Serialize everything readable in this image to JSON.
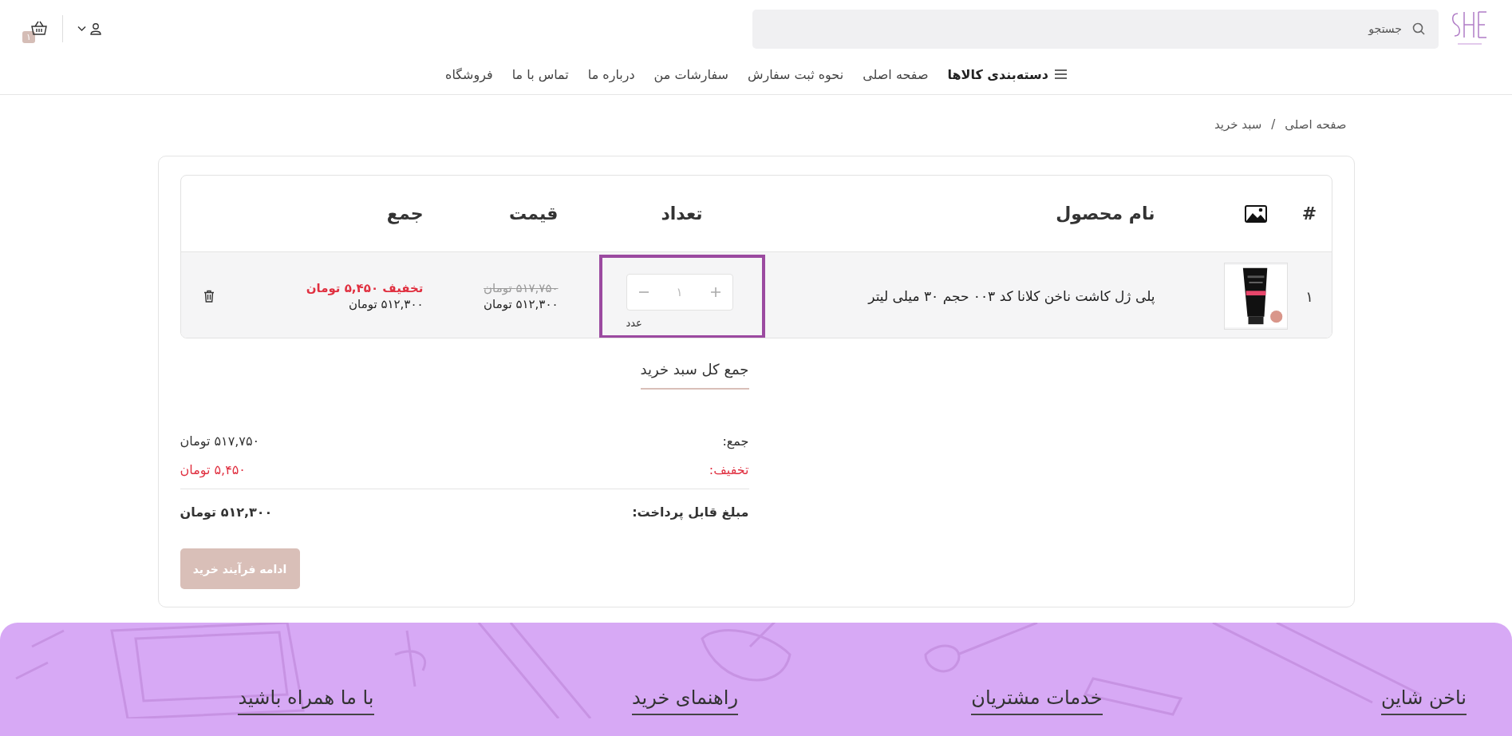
{
  "header": {
    "search": {
      "placeholder": "جستجو"
    },
    "cart_count": "۱"
  },
  "nav": [
    {
      "label": "دسته‌بندی کالاها",
      "kind": "menu"
    },
    {
      "label": "صفحه اصلی",
      "kind": "link"
    },
    {
      "label": "نحوه ثبت سفارش",
      "kind": "link"
    },
    {
      "label": "سفارشات من",
      "kind": "link"
    },
    {
      "label": "درباره ما",
      "kind": "link"
    },
    {
      "label": "تماس با ما",
      "kind": "link"
    },
    {
      "label": "فروشگاه",
      "kind": "link"
    }
  ],
  "breadcrumb": {
    "items": [
      "صفحه اصلی",
      "سبد خرید"
    ],
    "separator": "/"
  },
  "table": {
    "columns": [
      "#",
      "نام محصول",
      "تعداد",
      "قیمت",
      "جمع"
    ],
    "rows": [
      {
        "number": "۱",
        "name": "پلی ژل کاشت ناخن کلانا کد ۰۰۳ حجم ۳۰ میلی لیتر",
        "quantity": "۱",
        "unit": "عدد",
        "focused": true,
        "old_price": "۵۱۷,۷۵۰ تومان",
        "price": "۵۱۲,۳۰۰ تومان",
        "discount": "تخفیف  ۵,۴۵۰  تومان",
        "total": "۵۱۲,۳۰۰ تومان"
      }
    ]
  },
  "summary": {
    "title": "جمع کل سبد خرید",
    "lines": [
      {
        "label": "جمع:",
        "value": "۵۱۷,۷۵۰ تومان",
        "kind": "normal"
      },
      {
        "label": "تخفیف:",
        "value": "۵,۴۵۰ تومان",
        "kind": "discount"
      },
      {
        "label": "مبلغ قابل پرداخت:",
        "value": "۵۱۲,۳۰۰ تومان",
        "kind": "total"
      }
    ],
    "button": {
      "label": "ادامه فرآیند خرید",
      "disabled": true
    }
  },
  "footer": {
    "columns": [
      "ناخن شاین",
      "خدمات مشتریان",
      "راهنمای خرید",
      "با ما همراه باشید"
    ]
  }
}
